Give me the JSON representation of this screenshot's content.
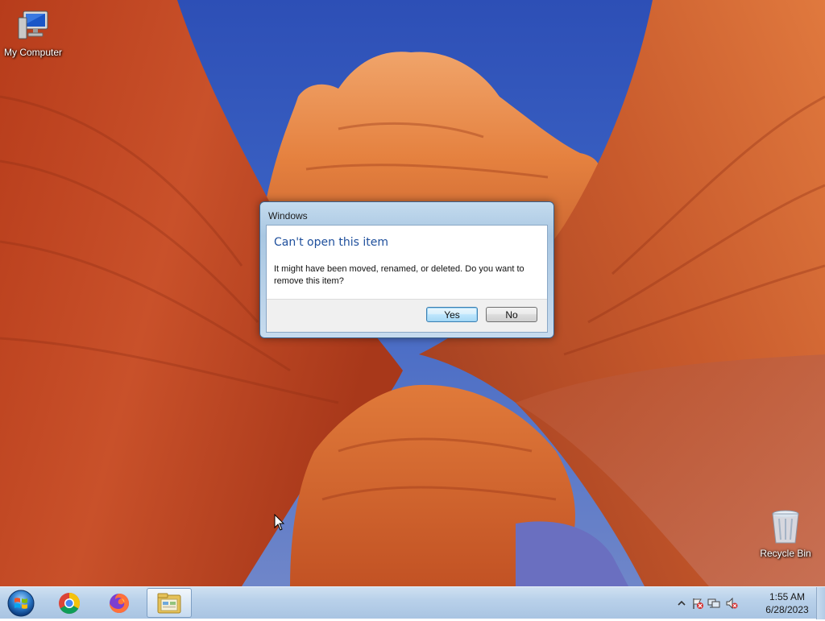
{
  "desktop": {
    "icons": [
      {
        "label": "My Computer",
        "icon": "computer-icon"
      },
      {
        "label": "Recycle Bin",
        "icon": "recycle-bin-icon"
      }
    ]
  },
  "dialog": {
    "title": "Windows",
    "instruction": "Can't open this item",
    "message": "It might have been moved, renamed, or deleted. Do you want to remove this item?",
    "buttons": {
      "yes": "Yes",
      "no": "No"
    }
  },
  "taskbar": {
    "start_icon": "windows-start-orb-icon",
    "pinned": [
      {
        "name": "Google Chrome",
        "icon": "chrome-icon"
      },
      {
        "name": "Firefox",
        "icon": "firefox-icon"
      },
      {
        "name": "Windows Explorer",
        "icon": "folder-explorer-icon",
        "active": true
      }
    ],
    "tray": {
      "icons": [
        "show-hidden-icons-chevron-icon",
        "action-center-flag-icon",
        "network-icon",
        "volume-muted-icon"
      ],
      "time": "1:55 AM",
      "date": "6/28/2023"
    }
  },
  "colors": {
    "instruction_text": "#1e4f9c",
    "taskbar": "#b9d1ea",
    "default_button_border": "#3c7fb1"
  }
}
